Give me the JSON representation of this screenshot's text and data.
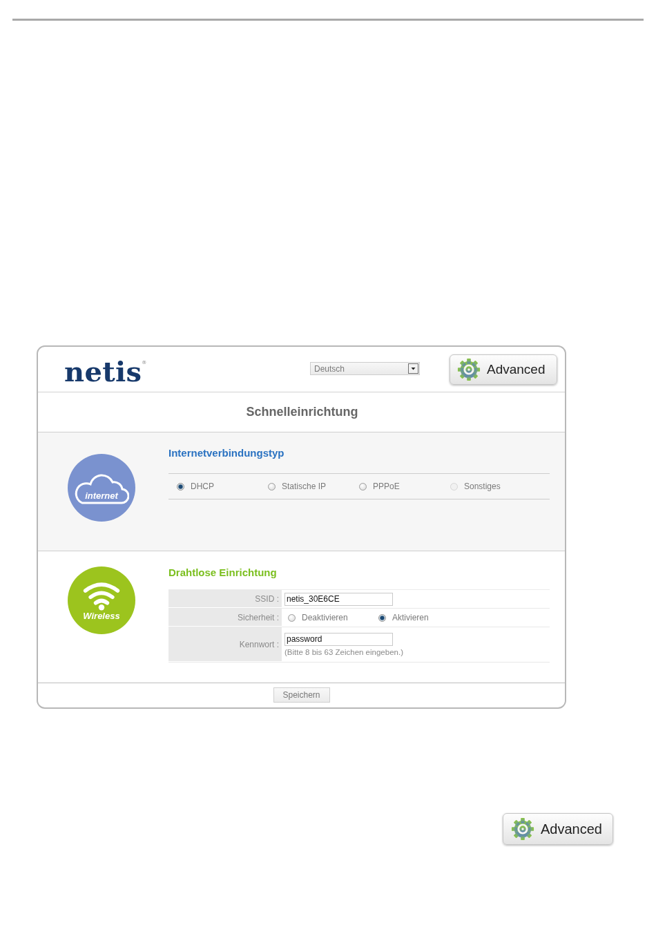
{
  "quick_setup_screen": {
    "header": {
      "logo": "netis$^{®}$",
      "language": {
        "value": "Deutsch"
      },
      "advanced_button": {
        "label": "Advanced"
      }
    },
    "title": "Schnelleinrichtung",
    "internet": {
      "badge_label": "internet",
      "heading": "Internetverbindungstyp",
      "options": [
        {
          "label": "DHCP",
          "selected": true,
          "disabled": false
        },
        {
          "label": "Statische IP",
          "selected": false,
          "disabled": false
        },
        {
          "label": "PPPoE",
          "selected": false,
          "disabled": false
        },
        {
          "label": "Sonstiges",
          "selected": false,
          "disabled": true
        }
      ]
    },
    "wireless": {
      "badge_label": "Wireless",
      "heading": "Drahtlose Einrichtung",
      "rows": [
        {
          "kind": "text",
          "label": "SSID :",
          "value": "netis_30E6CE"
        },
        {
          "kind": "radio",
          "label": "Sicherheit :",
          "options": [
            {
              "label": "Deaktivieren",
              "selected": false
            },
            {
              "label": "Aktivieren",
              "selected": true
            }
          ]
        },
        {
          "kind": "text",
          "label": "Kennwort :",
          "value": "password",
          "hint": "(Bitte 8 bis 63 Zeichen eingeben.)"
        }
      ]
    },
    "save_button": {
      "label": "Speichern"
    }
  },
  "advanced_button": {
    "label": "Advanced"
  }
}
